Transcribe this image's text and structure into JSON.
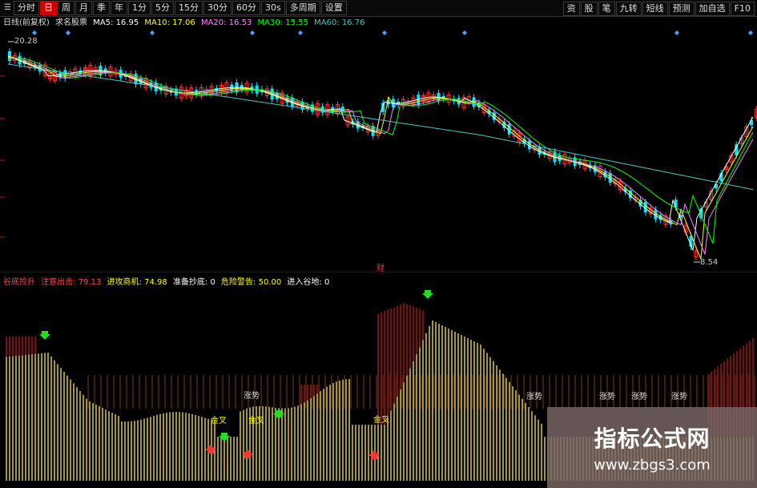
{
  "toolbar": {
    "items": [
      "分时",
      "日",
      "周",
      "月",
      "季",
      "年",
      "1分",
      "5分",
      "15分",
      "30分",
      "60分",
      "30s",
      "多周期",
      "设置"
    ],
    "active_index": 1,
    "right_items": [
      "资",
      "股",
      "笔",
      "九转",
      "短线",
      "预测",
      "加自选",
      "F10"
    ]
  },
  "main_legend": {
    "label": "日线(前复权)",
    "name": "求名股票",
    "ma5": "MA5: 16.95",
    "ma10": "MA10: 17.06",
    "ma20": "MA20: 16.53",
    "ma30": "MA30: 15.55",
    "ma60": "MA60: 16.76"
  },
  "price_labels": {
    "high": "20.28",
    "low": "8.54"
  },
  "marker_label": "财",
  "indicator_legend": {
    "name": "谷底捡升",
    "a": "注意出击: 79.13",
    "b": "进攻商机: 74.98",
    "c": "准备抄底: 0",
    "d": "危险警告: 50.00",
    "e": "进入谷地: 0"
  },
  "indicator_labels": {
    "jinjiao": "金叉",
    "zhangshi": "涨势"
  },
  "watermark": {
    "title": "指标公式网",
    "url": "www.zbgs3.com"
  },
  "colors": {
    "up": "#ff3232",
    "down": "#00e5ff",
    "ma5": "#ffffff",
    "ma10": "#ffff00",
    "ma20": "#ff80ff",
    "ma30": "#00ff00",
    "ma60": "#4fc3c3",
    "bar_yellow": "#e8d84a",
    "bar_red": "#b01818"
  },
  "icons": [
    "menu-icon",
    "diamond-marker-icon",
    "arrow-down-icon",
    "arrow-up-icon"
  ]
}
